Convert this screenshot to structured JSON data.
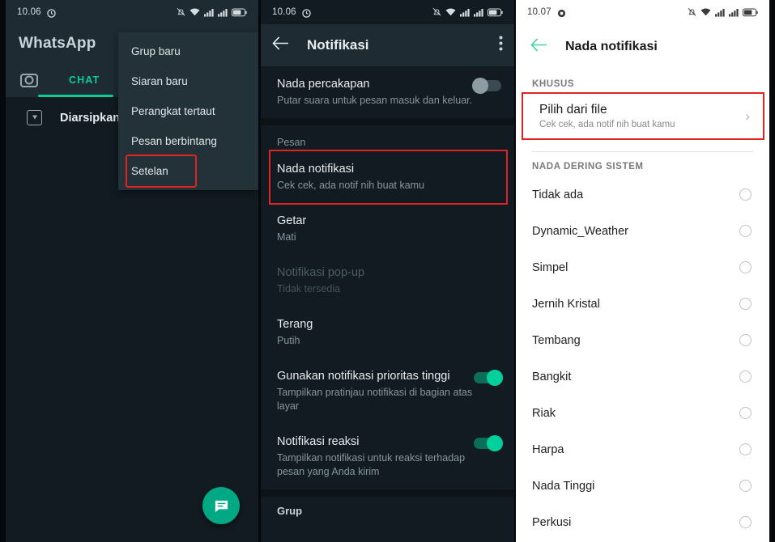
{
  "panel1": {
    "statusbar": {
      "time": "10.06",
      "icons": [
        "alarm-mute-icon",
        "wifi-icon",
        "signal-icon",
        "signal-icon",
        "battery-icon"
      ]
    },
    "header": {
      "title": "WhatsApp"
    },
    "tabs": {
      "camera_icon": "camera-icon",
      "chat_label": "CHAT"
    },
    "archived": {
      "label": "Diarsipkan",
      "icon": "archive-icon"
    },
    "menu": {
      "items": [
        {
          "label": "Grup baru",
          "highlighted": false
        },
        {
          "label": "Siaran baru",
          "highlighted": false
        },
        {
          "label": "Perangkat tertaut",
          "highlighted": false
        },
        {
          "label": "Pesan berbintang",
          "highlighted": false
        },
        {
          "label": "Setelan",
          "highlighted": true
        }
      ]
    },
    "fab": {
      "icon": "new-chat-icon"
    }
  },
  "panel2": {
    "statusbar": {
      "time": "10.06"
    },
    "nav": {
      "back_icon": "back-arrow-icon",
      "title": "Notifikasi",
      "overflow_icon": "overflow-menu-icon"
    },
    "items": [
      {
        "type": "toggle",
        "title": "Nada percakapan",
        "subtitle": "Putar suara untuk pesan masuk dan keluar.",
        "state": "off"
      },
      {
        "type": "section",
        "title": "Pesan"
      },
      {
        "type": "row",
        "title": "Nada notifikasi",
        "subtitle": "Cek cek, ada notif nih buat kamu",
        "highlighted": true
      },
      {
        "type": "row",
        "title": "Getar",
        "subtitle": "Mati"
      },
      {
        "type": "row",
        "title": "Notifikasi pop-up",
        "subtitle": "Tidak tersedia",
        "disabled": true
      },
      {
        "type": "row",
        "title": "Terang",
        "subtitle": "Putih"
      },
      {
        "type": "toggle",
        "title": "Gunakan notifikasi prioritas tinggi",
        "subtitle": "Tampilkan pratinjau notifikasi di bagian atas layar",
        "state": "on"
      },
      {
        "type": "toggle",
        "title": "Notifikasi reaksi",
        "subtitle": "Tampilkan notifikasi untuk reaksi terhadap pesan yang Anda kirim",
        "state": "on"
      },
      {
        "type": "section",
        "title": "Grup"
      }
    ]
  },
  "panel3": {
    "statusbar": {
      "time": "10.07"
    },
    "nav": {
      "back_icon": "back-arrow-icon",
      "title": "Nada notifikasi"
    },
    "custom_section": {
      "label": "KHUSUS",
      "title": "Pilih dari file",
      "subtitle": "Cek cek, ada notif nih buat kamu",
      "chevron": "chevron-right-icon"
    },
    "system_section": {
      "label": "NADA DERING SISTEM"
    },
    "tones": [
      {
        "label": "Tidak ada",
        "selected": false
      },
      {
        "label": "Dynamic_Weather",
        "selected": false
      },
      {
        "label": "Simpel",
        "selected": false
      },
      {
        "label": "Jernih Kristal",
        "selected": false
      },
      {
        "label": "Tembang",
        "selected": false
      },
      {
        "label": "Bangkit",
        "selected": false
      },
      {
        "label": "Riak",
        "selected": false
      },
      {
        "label": "Harpa",
        "selected": false
      },
      {
        "label": "Nada Tinggi",
        "selected": false
      },
      {
        "label": "Perkusi",
        "selected": false
      }
    ]
  },
  "colors": {
    "accent_green": "#00a884",
    "highlight_red": "#e02424",
    "dark_bg": "#111b21",
    "light_bg": "#ffffff"
  }
}
